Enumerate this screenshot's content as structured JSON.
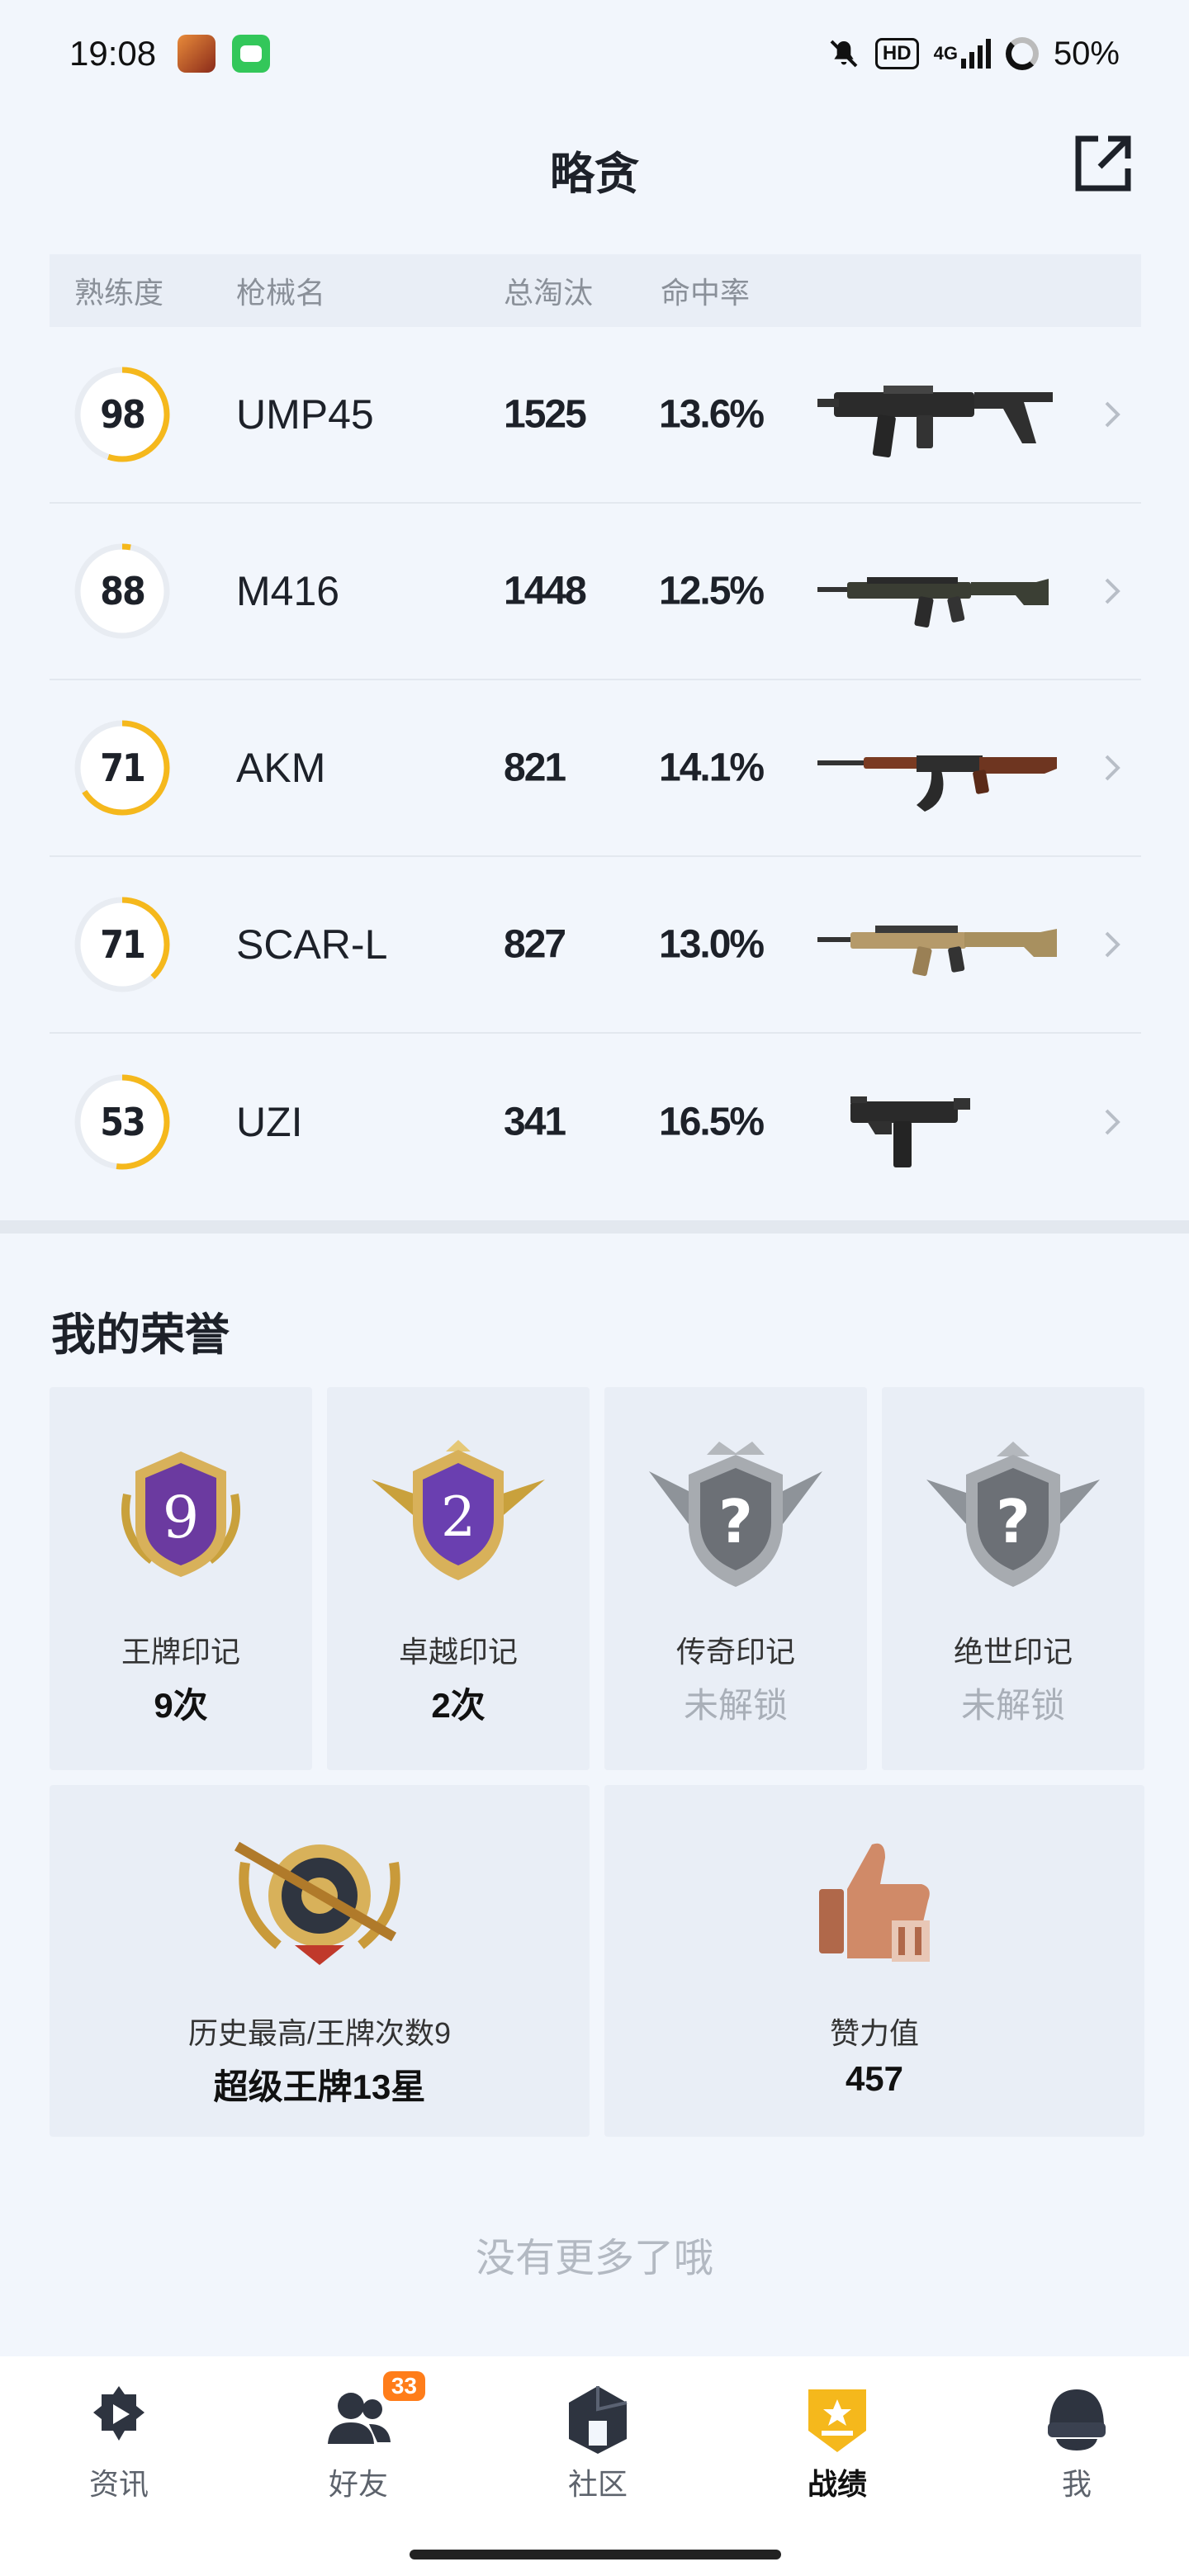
{
  "status_bar": {
    "time": "19:08",
    "hd": "HD",
    "network": "4G",
    "battery": "50%"
  },
  "header": {
    "title": "略贪"
  },
  "table": {
    "headers": [
      "熟练度",
      "枪械名",
      "总淘汰",
      "命中率"
    ],
    "rows": [
      {
        "proficiency": "98",
        "progress": 0.55,
        "name": "UMP45",
        "kills": "1525",
        "rate": "13.6%"
      },
      {
        "proficiency": "88",
        "progress": 0.03,
        "name": "M416",
        "kills": "1448",
        "rate": "12.5%"
      },
      {
        "proficiency": "71",
        "progress": 0.66,
        "name": "AKM",
        "kills": "821",
        "rate": "14.1%"
      },
      {
        "proficiency": "71",
        "progress": 0.38,
        "name": "SCAR-L",
        "kills": "827",
        "rate": "13.0%"
      },
      {
        "proficiency": "53",
        "progress": 0.52,
        "name": "UZI",
        "kills": "341",
        "rate": "16.5%"
      }
    ]
  },
  "honor": {
    "title": "我的荣誉",
    "marks": [
      {
        "label": "王牌印记",
        "value": "9次",
        "badge_text": "9",
        "locked": false
      },
      {
        "label": "卓越印记",
        "value": "2次",
        "badge_text": "2",
        "locked": false
      },
      {
        "label": "传奇印记",
        "value": "未解锁",
        "badge_text": "?",
        "locked": true
      },
      {
        "label": "绝世印记",
        "value": "未解锁",
        "badge_text": "?",
        "locked": true
      }
    ],
    "best": {
      "label": "历史最高/王牌次数9",
      "value": "超级王牌13星"
    },
    "likes": {
      "label": "赞力值",
      "value": "457"
    }
  },
  "footer_text": "没有更多了哦",
  "tabs": [
    {
      "label": "资讯",
      "icon": "news-icon",
      "active": false
    },
    {
      "label": "好友",
      "icon": "friends-icon",
      "badge": "33",
      "active": false
    },
    {
      "label": "社区",
      "icon": "community-icon",
      "active": false
    },
    {
      "label": "战绩",
      "icon": "record-icon",
      "active": true
    },
    {
      "label": "我",
      "icon": "profile-icon",
      "active": false
    }
  ],
  "colors": {
    "accent": "#f5b81c",
    "ring_track": "#e8ecf2",
    "background": "#f2f6fc",
    "badge": "#ff7d1a"
  }
}
